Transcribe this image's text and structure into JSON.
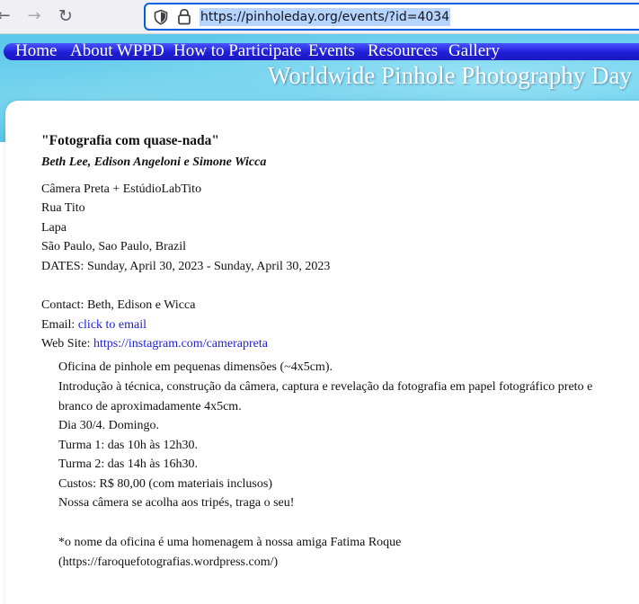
{
  "browser": {
    "url": "https://pinholeday.org/events/?id=4034"
  },
  "site": {
    "nav": [
      "Home",
      "About WPPD",
      "How to Participate",
      "Events",
      "Resources",
      "Gallery"
    ],
    "title": "Worldwide Pinhole Photography Day"
  },
  "event": {
    "title": "\"Fotografia com quase-nada\"",
    "authors": "Beth Lee, Edison Angeloni e Simone Wicca",
    "address": [
      "Câmera Preta + EstúdioLabTito",
      "Rua Tito",
      "Lapa",
      "São Paulo, Sao Paulo, Brazil"
    ],
    "dates": "DATES: Sunday, April 30, 2023 - Sunday, April 30, 2023",
    "contact_label": "Contact:",
    "contact_value": "Beth, Edison e Wicca",
    "email_label": "Email:",
    "email_link": "click to email",
    "website_label": "Web Site:",
    "website_link": "https://instagram.com/camerapreta",
    "description": [
      "Oficina de pinhole em pequenas dimensões (~4x5cm).",
      "Introdução à técnica, construção da câmera, captura e revelação da fotografia em papel fotográfico preto e",
      "branco de aproximadamente 4x5cm.",
      "Dia 30/4. Domingo.",
      "Turma 1: das 10h às 12h30.",
      "Turma 2: das 14h às 16h30.",
      "Custos: R$ 80,00 (com materiais inclusos)",
      "Nossa câmera se acolha aos tripés, traga o seu!",
      "",
      "*o nome da oficina é uma homenagem à nossa amiga Fatima Roque",
      "(https://faroquefotografias.wordpress.com/)"
    ]
  }
}
